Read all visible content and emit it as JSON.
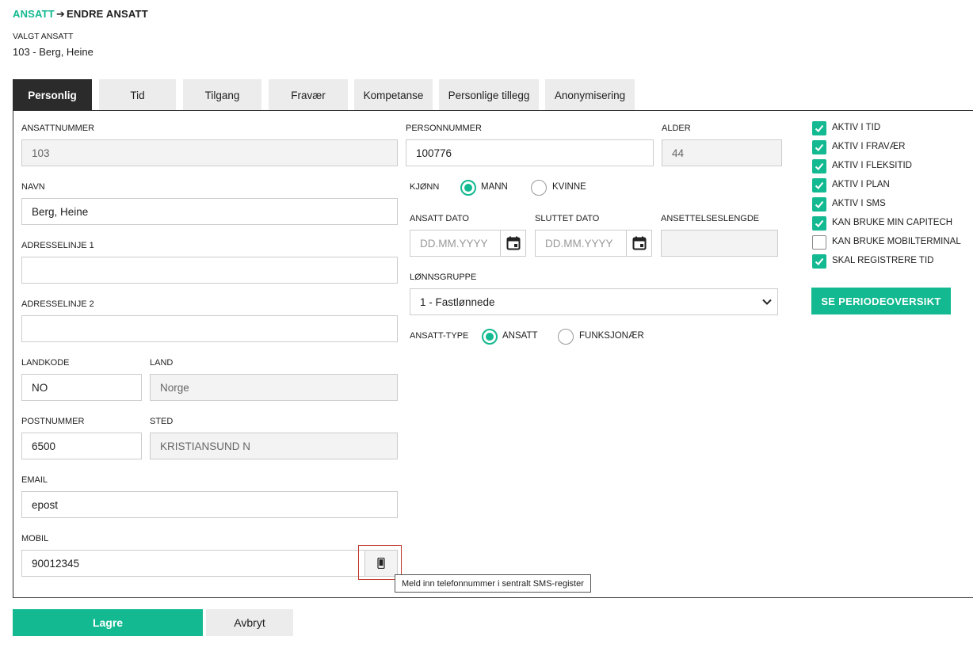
{
  "breadcrumb": {
    "parent": "ANSATT",
    "current": "ENDRE ANSATT"
  },
  "selected": {
    "label": "VALGT ANSATT",
    "value": "103 - Berg, Heine"
  },
  "tabs": [
    {
      "label": "Personlig",
      "active": true
    },
    {
      "label": "Tid"
    },
    {
      "label": "Tilgang"
    },
    {
      "label": "Fravær"
    },
    {
      "label": "Kompetanse"
    },
    {
      "label": "Personlige tillegg"
    },
    {
      "label": "Anonymisering"
    }
  ],
  "form": {
    "ansattnummer": {
      "label": "ANSATTNUMMER",
      "value": "103"
    },
    "navn": {
      "label": "NAVN",
      "value": "Berg, Heine"
    },
    "adresse1": {
      "label": "ADRESSELINJE 1",
      "value": ""
    },
    "adresse2": {
      "label": "ADRESSELINJE 2",
      "value": ""
    },
    "landkode": {
      "label": "LANDKODE",
      "value": "NO"
    },
    "land": {
      "label": "LAND",
      "value": "Norge"
    },
    "postnummer": {
      "label": "POSTNUMMER",
      "value": "6500"
    },
    "sted": {
      "label": "STED",
      "value": "KRISTIANSUND N"
    },
    "email": {
      "label": "EMAIL",
      "value": "epost"
    },
    "mobil": {
      "label": "MOBIL",
      "value": "90012345"
    },
    "personnummer": {
      "label": "PERSONNUMMER",
      "value": "100776"
    },
    "alder": {
      "label": "ALDER",
      "value": "44"
    },
    "kjonn": {
      "label": "KJØNN",
      "options": [
        "MANN",
        "KVINNE"
      ],
      "selected": "MANN"
    },
    "ansatt_dato": {
      "label": "ANSATT DATO",
      "placeholder": "DD.MM.YYYY"
    },
    "sluttet_dato": {
      "label": "SLUTTET DATO",
      "placeholder": "DD.MM.YYYY"
    },
    "ansettelseslengde": {
      "label": "ANSETTELSESLENGDE",
      "value": ""
    },
    "lonnsgruppe": {
      "label": "LØNNSGRUPPE",
      "value": "1 - Fastlønnede"
    },
    "ansatt_type": {
      "label": "ANSATT-TYPE",
      "options": [
        "ANSATT",
        "FUNKSJONÆR"
      ],
      "selected": "ANSATT"
    }
  },
  "checkboxes": [
    {
      "label": "AKTIV I TID",
      "checked": true
    },
    {
      "label": "AKTIV I FRAVÆR",
      "checked": true
    },
    {
      "label": "AKTIV I FLEKSITID",
      "checked": true
    },
    {
      "label": "AKTIV I PLAN",
      "checked": true
    },
    {
      "label": "AKTIV I SMS",
      "checked": true
    },
    {
      "label": "KAN BRUKE MIN CAPITECH",
      "checked": true
    },
    {
      "label": "KAN BRUKE MOBILTERMINAL",
      "checked": false
    },
    {
      "label": "SKAL REGISTRERE TID",
      "checked": true
    }
  ],
  "period_button": "SE PERIODEOVERSIKT",
  "tooltip": "Meld inn telefonnummer i sentralt SMS-register",
  "actions": {
    "save": "Lagre",
    "cancel": "Avbryt"
  },
  "colors": {
    "accent": "#13b990",
    "dark_tab": "#2b2b2b"
  },
  "icons": {
    "calendar": "calendar-icon",
    "mobile": "mobile-phone-icon",
    "chevron": "chevron-down-icon",
    "check": "checkmark-icon"
  }
}
